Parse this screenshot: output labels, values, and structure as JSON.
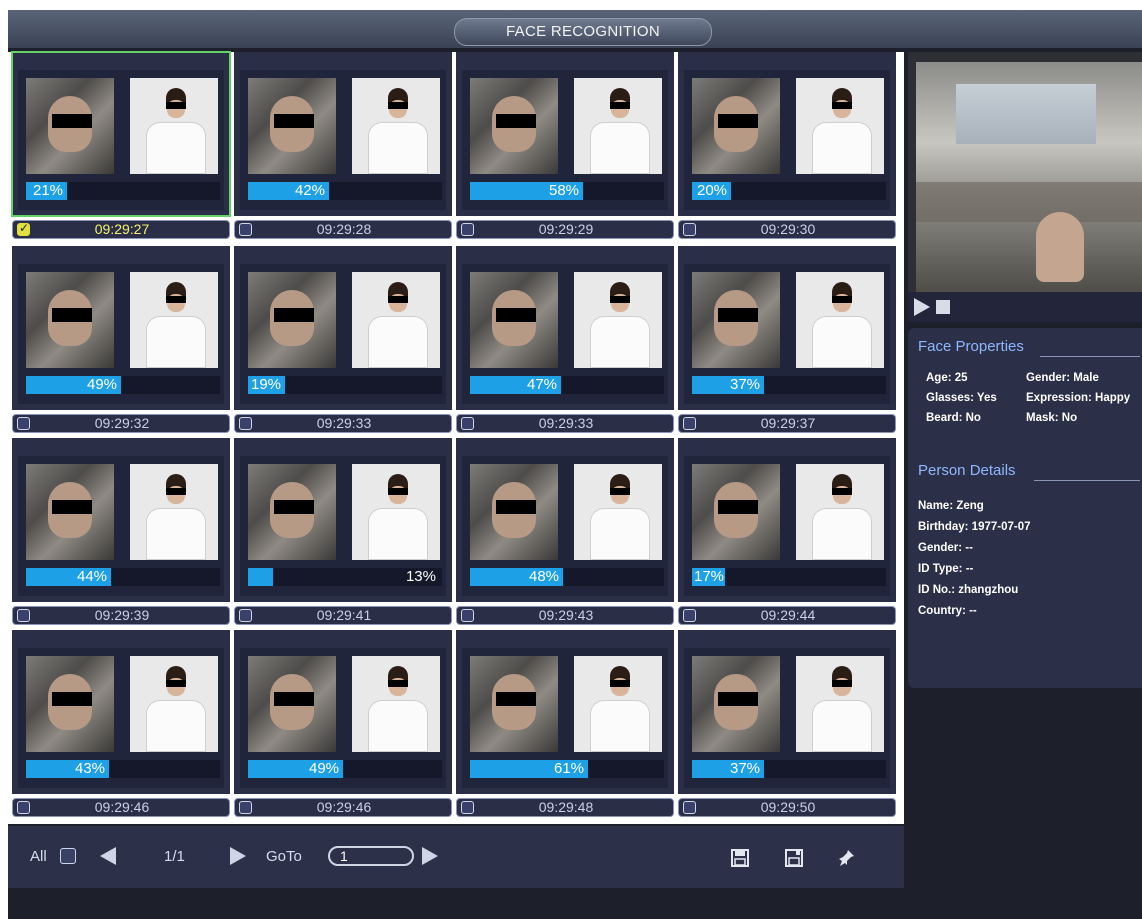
{
  "window": {
    "title": "FACE RECOGNITION"
  },
  "cards": [
    {
      "time": "09:29:27",
      "percent": 21,
      "label": "21%",
      "checked": true
    },
    {
      "time": "09:29:28",
      "percent": 42,
      "label": "42%",
      "checked": false
    },
    {
      "time": "09:29:29",
      "percent": 58,
      "label": "58%",
      "checked": false
    },
    {
      "time": "09:29:30",
      "percent": 20,
      "label": "20%",
      "checked": false
    },
    {
      "time": "09:29:32",
      "percent": 49,
      "label": "49%",
      "checked": false
    },
    {
      "time": "09:29:33",
      "percent": 19,
      "label": "19%",
      "checked": false
    },
    {
      "time": "09:29:33",
      "percent": 47,
      "label": "47%",
      "checked": false
    },
    {
      "time": "09:29:37",
      "percent": 37,
      "label": "37%",
      "checked": false
    },
    {
      "time": "09:29:39",
      "percent": 44,
      "label": "44%",
      "checked": false
    },
    {
      "time": "09:29:41",
      "percent": 13,
      "label": "13%",
      "checked": false
    },
    {
      "time": "09:29:43",
      "percent": 48,
      "label": "48%",
      "checked": false
    },
    {
      "time": "09:29:44",
      "percent": 17,
      "label": "17%",
      "checked": false
    },
    {
      "time": "09:29:46",
      "percent": 43,
      "label": "43%",
      "checked": false
    },
    {
      "time": "09:29:46",
      "percent": 49,
      "label": "49%",
      "checked": false
    },
    {
      "time": "09:29:48",
      "percent": 61,
      "label": "61%",
      "checked": false
    },
    {
      "time": "09:29:50",
      "percent": 37,
      "label": "37%",
      "checked": false
    }
  ],
  "face_properties": {
    "title": "Face Properties",
    "age": "Age: 25",
    "gender": "Gender: Male",
    "glasses": "Glasses: Yes",
    "expression": "Expression: Happy",
    "beard": "Beard: No",
    "mask": "Mask: No"
  },
  "person_details": {
    "title": "Person Details",
    "name": "Name: Zeng",
    "birthday": "Birthday: 1977-07-07",
    "gender": "Gender: --",
    "id_type": "ID Type: --",
    "id_no": "ID No.: zhangzhou",
    "country": "Country: --"
  },
  "footer": {
    "all_label": "All",
    "page": "1/1",
    "goto_label": "GoTo",
    "goto_value": "1"
  },
  "icons": {
    "save": "save-icon",
    "save_as": "save-as-icon",
    "pin": "pin-icon",
    "prev": "chevron-left-icon",
    "next": "chevron-right-icon",
    "play": "play-icon",
    "stop": "stop-icon"
  }
}
